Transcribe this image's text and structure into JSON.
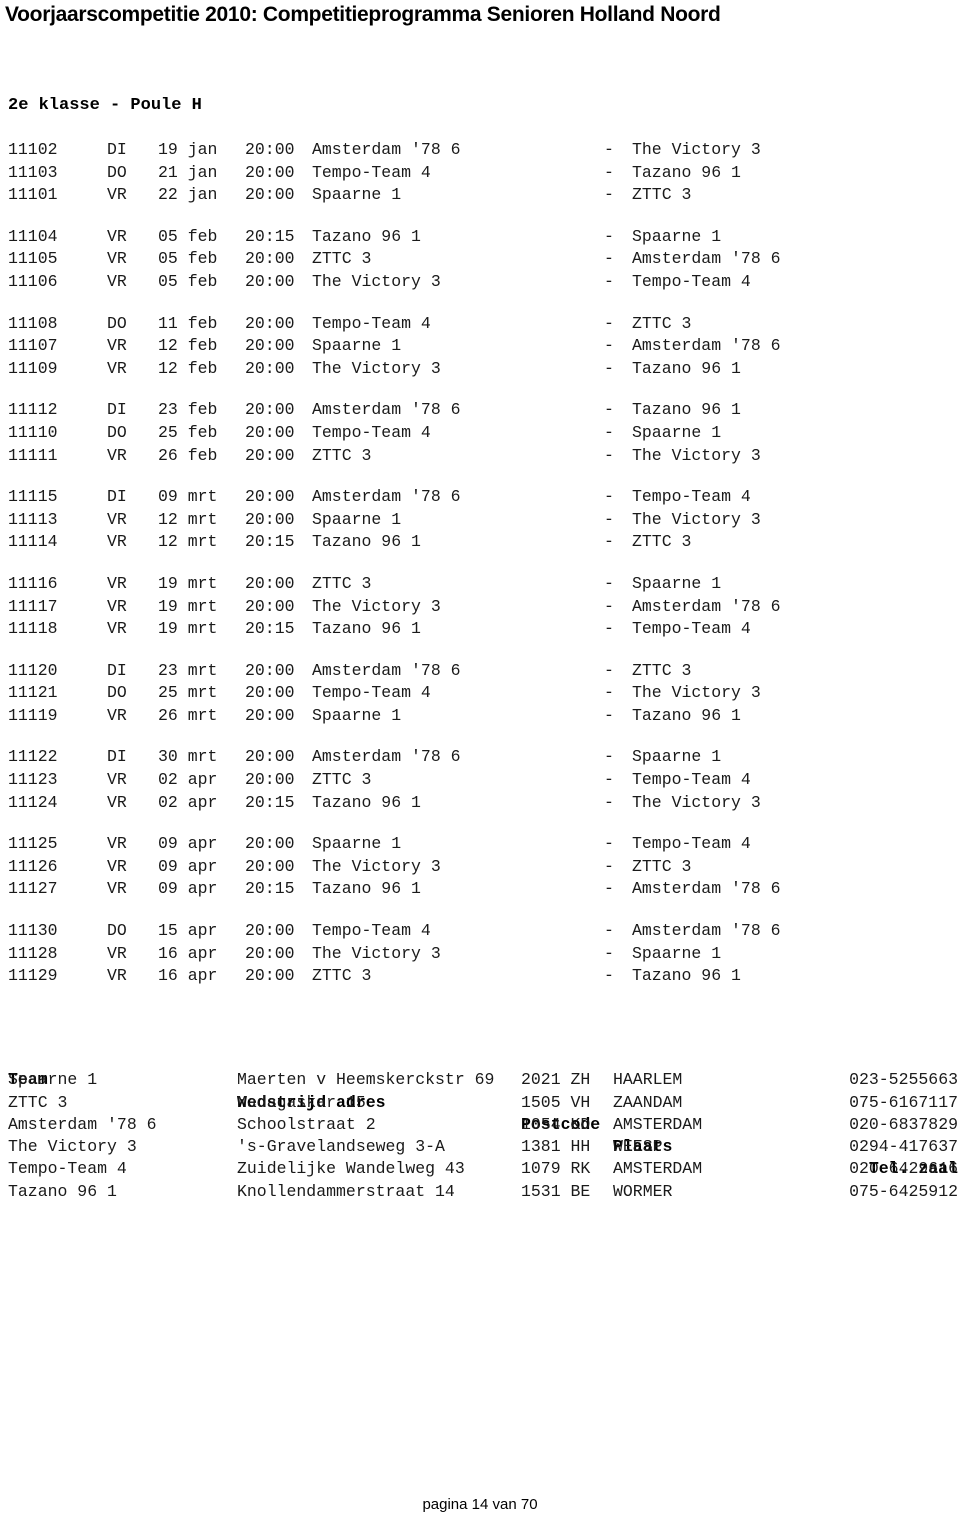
{
  "document": {
    "title": "Voorjaarscompetitie 2010: Competitieprogramma Senioren Holland Noord",
    "poule_heading": "2e klasse - Poule H",
    "footer": "pagina 14 van 70"
  },
  "schedule": {
    "blocks": [
      {
        "matches": [
          {
            "code": "11102",
            "day": "DI",
            "date": "19 jan",
            "time": "20:00",
            "home": "Amsterdam '78 6",
            "dash": "-",
            "away": "The Victory 3"
          },
          {
            "code": "11103",
            "day": "DO",
            "date": "21 jan",
            "time": "20:00",
            "home": "Tempo-Team 4",
            "dash": "-",
            "away": "Tazano 96 1"
          },
          {
            "code": "11101",
            "day": "VR",
            "date": "22 jan",
            "time": "20:00",
            "home": "Spaarne 1",
            "dash": "-",
            "away": "ZTTC 3"
          }
        ]
      },
      {
        "matches": [
          {
            "code": "11104",
            "day": "VR",
            "date": "05 feb",
            "time": "20:15",
            "home": "Tazano 96 1",
            "dash": "-",
            "away": "Spaarne 1"
          },
          {
            "code": "11105",
            "day": "VR",
            "date": "05 feb",
            "time": "20:00",
            "home": "ZTTC 3",
            "dash": "-",
            "away": "Amsterdam '78 6"
          },
          {
            "code": "11106",
            "day": "VR",
            "date": "05 feb",
            "time": "20:00",
            "home": "The Victory 3",
            "dash": "-",
            "away": "Tempo-Team 4"
          }
        ]
      },
      {
        "matches": [
          {
            "code": "11108",
            "day": "DO",
            "date": "11 feb",
            "time": "20:00",
            "home": "Tempo-Team 4",
            "dash": "-",
            "away": "ZTTC 3"
          },
          {
            "code": "11107",
            "day": "VR",
            "date": "12 feb",
            "time": "20:00",
            "home": "Spaarne 1",
            "dash": "-",
            "away": "Amsterdam '78 6"
          },
          {
            "code": "11109",
            "day": "VR",
            "date": "12 feb",
            "time": "20:00",
            "home": "The Victory 3",
            "dash": "-",
            "away": "Tazano 96 1"
          }
        ]
      },
      {
        "matches": [
          {
            "code": "11112",
            "day": "DI",
            "date": "23 feb",
            "time": "20:00",
            "home": "Amsterdam '78 6",
            "dash": "-",
            "away": "Tazano 96 1"
          },
          {
            "code": "11110",
            "day": "DO",
            "date": "25 feb",
            "time": "20:00",
            "home": "Tempo-Team 4",
            "dash": "-",
            "away": "Spaarne 1"
          },
          {
            "code": "11111",
            "day": "VR",
            "date": "26 feb",
            "time": "20:00",
            "home": "ZTTC 3",
            "dash": "-",
            "away": "The Victory 3"
          }
        ]
      },
      {
        "matches": [
          {
            "code": "11115",
            "day": "DI",
            "date": "09 mrt",
            "time": "20:00",
            "home": "Amsterdam '78 6",
            "dash": "-",
            "away": "Tempo-Team 4"
          },
          {
            "code": "11113",
            "day": "VR",
            "date": "12 mrt",
            "time": "20:00",
            "home": "Spaarne 1",
            "dash": "-",
            "away": "The Victory 3"
          },
          {
            "code": "11114",
            "day": "VR",
            "date": "12 mrt",
            "time": "20:15",
            "home": "Tazano 96 1",
            "dash": "-",
            "away": "ZTTC 3"
          }
        ]
      },
      {
        "matches": [
          {
            "code": "11116",
            "day": "VR",
            "date": "19 mrt",
            "time": "20:00",
            "home": "ZTTC 3",
            "dash": "-",
            "away": "Spaarne 1"
          },
          {
            "code": "11117",
            "day": "VR",
            "date": "19 mrt",
            "time": "20:00",
            "home": "The Victory 3",
            "dash": "-",
            "away": "Amsterdam '78 6"
          },
          {
            "code": "11118",
            "day": "VR",
            "date": "19 mrt",
            "time": "20:15",
            "home": "Tazano 96 1",
            "dash": "-",
            "away": "Tempo-Team 4"
          }
        ]
      },
      {
        "matches": [
          {
            "code": "11120",
            "day": "DI",
            "date": "23 mrt",
            "time": "20:00",
            "home": "Amsterdam '78 6",
            "dash": "-",
            "away": "ZTTC 3"
          },
          {
            "code": "11121",
            "day": "DO",
            "date": "25 mrt",
            "time": "20:00",
            "home": "Tempo-Team 4",
            "dash": "-",
            "away": "The Victory 3"
          },
          {
            "code": "11119",
            "day": "VR",
            "date": "26 mrt",
            "time": "20:00",
            "home": "Spaarne 1",
            "dash": "-",
            "away": "Tazano 96 1"
          }
        ]
      },
      {
        "matches": [
          {
            "code": "11122",
            "day": "DI",
            "date": "30 mrt",
            "time": "20:00",
            "home": "Amsterdam '78 6",
            "dash": "-",
            "away": "Spaarne 1"
          },
          {
            "code": "11123",
            "day": "VR",
            "date": "02 apr",
            "time": "20:00",
            "home": "ZTTC 3",
            "dash": "-",
            "away": "Tempo-Team 4"
          },
          {
            "code": "11124",
            "day": "VR",
            "date": "02 apr",
            "time": "20:15",
            "home": "Tazano 96 1",
            "dash": "-",
            "away": "The Victory 3"
          }
        ]
      },
      {
        "matches": [
          {
            "code": "11125",
            "day": "VR",
            "date": "09 apr",
            "time": "20:00",
            "home": "Spaarne 1",
            "dash": "-",
            "away": "Tempo-Team 4"
          },
          {
            "code": "11126",
            "day": "VR",
            "date": "09 apr",
            "time": "20:00",
            "home": "The Victory 3",
            "dash": "-",
            "away": "ZTTC 3"
          },
          {
            "code": "11127",
            "day": "VR",
            "date": "09 apr",
            "time": "20:15",
            "home": "Tazano 96 1",
            "dash": "-",
            "away": "Amsterdam '78 6"
          }
        ]
      },
      {
        "matches": [
          {
            "code": "11130",
            "day": "DO",
            "date": "15 apr",
            "time": "20:00",
            "home": "Tempo-Team 4",
            "dash": "-",
            "away": "Amsterdam '78 6"
          },
          {
            "code": "11128",
            "day": "VR",
            "date": "16 apr",
            "time": "20:00",
            "home": "The Victory 3",
            "dash": "-",
            "away": "Spaarne 1"
          },
          {
            "code": "11129",
            "day": "VR",
            "date": "16 apr",
            "time": "20:00",
            "home": "ZTTC 3",
            "dash": "-",
            "away": "Tazano 96 1"
          }
        ]
      }
    ]
  },
  "address_table": {
    "headers": {
      "team": "Team",
      "address": "Wedstrijd adres",
      "postcode": "Postcode",
      "city": "Plaats",
      "phone": "Tel. zaal"
    },
    "rows": [
      {
        "team": "Spaarne 1",
        "address": "Maerten v Heemskerckstr 69",
        "postcode": "2021 ZH",
        "city": "HAARLEM",
        "phone": "023-5255663"
      },
      {
        "team": "ZTTC 3",
        "address": "Madagaskar 15",
        "postcode": "1505 VH",
        "city": "ZAANDAM",
        "phone": "075-6167117"
      },
      {
        "team": "Amsterdam '78 6",
        "address": "Schoolstraat 2",
        "postcode": "1054 KD",
        "city": "AMSTERDAM",
        "phone": "020-6837829"
      },
      {
        "team": "The Victory 3",
        "address": "'s-Gravelandseweg 3-A",
        "postcode": "1381 HH",
        "city": "WEESP",
        "phone": "0294-417637"
      },
      {
        "team": "Tempo-Team 4",
        "address": "Zuidelijke Wandelweg 43",
        "postcode": "1079 RK",
        "city": "AMSTERDAM",
        "phone": "020-6429616"
      },
      {
        "team": "Tazano 96 1",
        "address": "Knollendammerstraat 14",
        "postcode": "1531 BE",
        "city": "WORMER",
        "phone": "075-6425912"
      }
    ]
  }
}
